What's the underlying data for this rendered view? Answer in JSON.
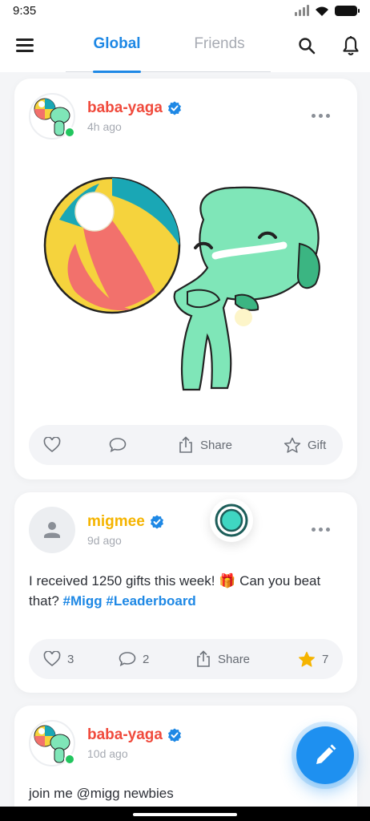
{
  "status_bar": {
    "time": "9:35"
  },
  "header": {
    "tabs": [
      {
        "label": "Global",
        "active": true
      },
      {
        "label": "Friends",
        "active": false
      }
    ]
  },
  "posts": [
    {
      "username": "baba-yaga",
      "username_color": "#f04a3c",
      "verified": true,
      "online": true,
      "time_ago": "4h ago",
      "media": "sticker: green dinosaur holding beach ball",
      "actions": {
        "share_label": "Share",
        "gift_label": "Gift"
      }
    },
    {
      "username": "migmee",
      "username_color": "#f5b400",
      "verified": true,
      "online": false,
      "time_ago": "9d ago",
      "text": "I received 1250 gifts this week! 🎁 Can you beat that?",
      "hashtags": [
        "#Migg",
        "#Leaderboard"
      ],
      "actions": {
        "likes": "3",
        "comments": "2",
        "share_label": "Share",
        "stars": "7"
      }
    },
    {
      "username": "baba-yaga",
      "username_color": "#f04a3c",
      "verified": true,
      "online": true,
      "time_ago": "10d ago",
      "text": "join me @migg newbies"
    }
  ],
  "colors": {
    "accent": "#1e88e5",
    "fab": "#1e90f0",
    "online": "#22c55e",
    "star": "#f5b400"
  },
  "icons": [
    "menu-icon",
    "search-icon",
    "bell-icon",
    "heart-icon",
    "comment-icon",
    "share-icon",
    "star-icon",
    "more-icon",
    "verified-icon",
    "pencil-icon",
    "user-placeholder-icon"
  ]
}
